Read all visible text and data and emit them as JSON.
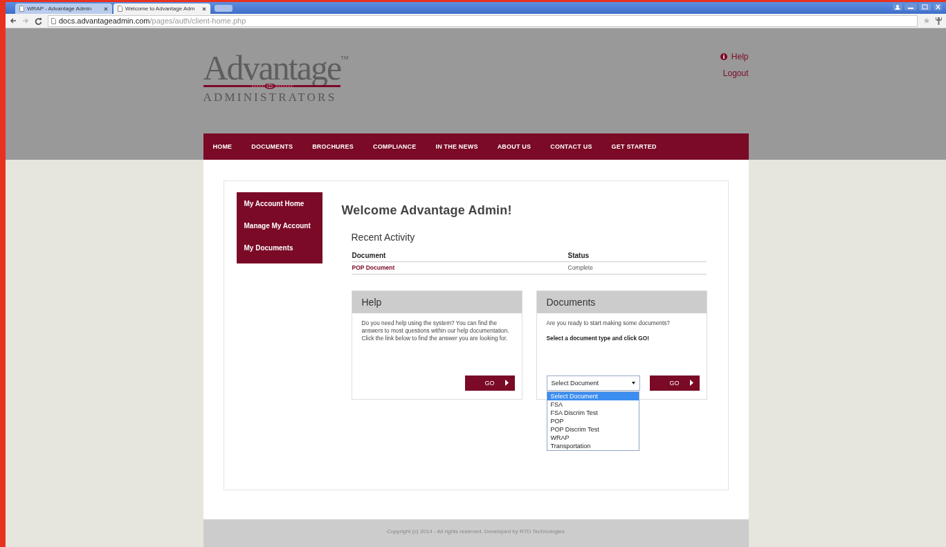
{
  "browser": {
    "tabs": [
      {
        "title": "WRAP - Advantage Admin",
        "selected": false
      },
      {
        "title": "Welcome to Advantage Adm",
        "selected": true
      }
    ],
    "url_host": "docs.advantageadmin.com",
    "url_path": "/pages/auth/client-home.php"
  },
  "header": {
    "logo": {
      "word": "Advantage",
      "trademark": "TM",
      "subtitle": "ADMINISTRATORS"
    },
    "links": [
      {
        "kind": "help",
        "label": "Help"
      },
      {
        "kind": "plain",
        "label": "Logout"
      }
    ]
  },
  "nav": [
    "HOME",
    "DOCUMENTS",
    "BROCHURES",
    "COMPLIANCE",
    "IN THE NEWS",
    "ABOUT US",
    "CONTACT US",
    "GET STARTED"
  ],
  "sidebar": {
    "items": [
      "My Account Home",
      "Manage My Account",
      "My Documents"
    ]
  },
  "welcome": "Welcome Advantage Admin!",
  "recent_activity": {
    "title": "Recent Activity",
    "columns": [
      "Document",
      "Status"
    ],
    "rows": [
      {
        "document": "POP Document",
        "status": "Complete"
      }
    ]
  },
  "panels": [
    {
      "kind": "help",
      "title": "Help",
      "text": "Do you need help using the system? You can find the answers to most questions within our help documentation. Click the link below to find the answer you are looking for.",
      "button": "GO"
    },
    {
      "kind": "documents",
      "title": "Documents",
      "text": "Are you ready to start making some documents?",
      "bold_text": "Select a document type and click GO!",
      "select": {
        "value": "Select Document",
        "expanded": true,
        "options": [
          {
            "label": "Select Document",
            "selected": true
          },
          {
            "label": "FSA",
            "selected": false
          },
          {
            "label": "FSA Discrim Test",
            "selected": false
          },
          {
            "label": "POP",
            "selected": false
          },
          {
            "label": "POP Discrim Test",
            "selected": false
          },
          {
            "label": "WRAP",
            "selected": false
          },
          {
            "label": "Transportation",
            "selected": false
          }
        ]
      },
      "button": "GO"
    }
  ],
  "footer": "Copyright (c) 2014 - All rights reserved. Developed by RTD Technologies"
}
